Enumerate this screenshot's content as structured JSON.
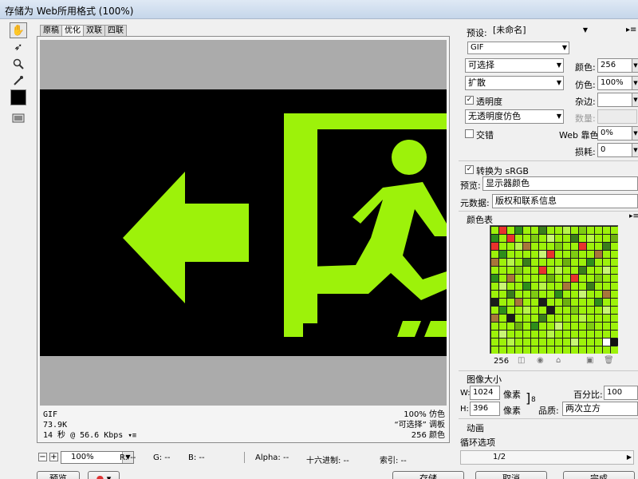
{
  "window": {
    "title": "存储为 Web所用格式 (100%)"
  },
  "tabs": [
    {
      "label": "原稿",
      "active": false
    },
    {
      "label": "优化",
      "active": true
    },
    {
      "label": "双联",
      "active": false
    },
    {
      "label": "四联",
      "active": false
    }
  ],
  "tools": [
    "hand-icon",
    "slice-select-icon",
    "zoom-icon",
    "eyedropper-icon"
  ],
  "colors": {
    "sign_green": "#9df20a",
    "sign_black": "#000000",
    "canvas_gray": "#ababab"
  },
  "info": {
    "format": "GIF",
    "size": "73.9K",
    "time": "14 秒 @ 56.6 Kbps",
    "dither": "100% 仿色",
    "palette": "“可选择” 调板",
    "colors": "256 颜色"
  },
  "status": {
    "zoom": "100%",
    "r": "R: --",
    "g": "G: --",
    "b": "B: --",
    "alpha": "Alpha: --",
    "hex": "十六进制: --",
    "index": "索引: --"
  },
  "buttons": {
    "preview": "预览",
    "save": "存储",
    "cancel": "取消",
    "done": "完成"
  },
  "settings": {
    "preset_label": "预设:",
    "preset_value": "[未命名]",
    "format": "GIF",
    "reduction": "可选择",
    "colors_label": "颜色:",
    "colors_value": "256",
    "dither_algo": "扩散",
    "dither_label": "仿色:",
    "dither_value": "100%",
    "transparency_label": "透明度",
    "transparency_checked": true,
    "matte_label": "杂边:",
    "trans_dither": "无透明度仿色",
    "amount_label": "数量:",
    "interlaced_label": "交错",
    "interlaced_checked": false,
    "websnap_label": "Web 靠色:",
    "websnap_value": "0%",
    "lossy_label": "损耗:",
    "lossy_value": "0",
    "srgb_label": "转换为 sRGB",
    "srgb_checked": true,
    "preview_label": "预览:",
    "preview_value": "显示器颜色",
    "metadata_label": "元数据:",
    "metadata_value": "版权和联系信息"
  },
  "color_table": {
    "title": "颜色表",
    "count": "256",
    "swatches": [
      "#9df20a",
      "#e8332d",
      "#9df20a",
      "#2d8e1a",
      "#9df20a",
      "#9df20a",
      "#3a7d1b",
      "#9df20a",
      "#9df20a",
      "#b8f54a",
      "#9df20a",
      "#7fcc12",
      "#9df20a",
      "#9df20a",
      "#9df20a",
      "#9df20a",
      "#2d8e1a",
      "#9df20a",
      "#e8332d",
      "#9df20a",
      "#9df20a",
      "#7fcc12",
      "#9df20a",
      "#c9f575",
      "#9df20a",
      "#9df20a",
      "#3a7d1b",
      "#9df20a",
      "#b8f54a",
      "#9df20a",
      "#9df20a",
      "#6db00f",
      "#e8332d",
      "#9df20a",
      "#9df20a",
      "#b8f54a",
      "#a8763a",
      "#9df20a",
      "#9df20a",
      "#9df20a",
      "#7fcc12",
      "#9df20a",
      "#9df20a",
      "#e8332d",
      "#9df20a",
      "#9df20a",
      "#3a7d1b",
      "#9df20a",
      "#9df20a",
      "#2d8e1a",
      "#9df20a",
      "#9df20a",
      "#9df20a",
      "#9df20a",
      "#c9f575",
      "#e8332d",
      "#9df20a",
      "#9df20a",
      "#7fcc12",
      "#9df20a",
      "#9df20a",
      "#a8763a",
      "#9df20a",
      "#9df20a",
      "#a8763a",
      "#9df20a",
      "#b8f54a",
      "#9df20a",
      "#3a7d1b",
      "#9df20a",
      "#9df20a",
      "#9df20a",
      "#9df20a",
      "#6db00f",
      "#9df20a",
      "#9df20a",
      "#2d8e1a",
      "#9df20a",
      "#9df20a",
      "#9df20a",
      "#9df20a",
      "#9df20a",
      "#9df20a",
      "#7fcc12",
      "#9df20a",
      "#9df20a",
      "#e8332d",
      "#9df20a",
      "#b8f54a",
      "#9df20a",
      "#9df20a",
      "#3a7d1b",
      "#9df20a",
      "#9df20a",
      "#c9f575",
      "#9df20a",
      "#2d8e1a",
      "#9df20a",
      "#a8763a",
      "#9df20a",
      "#9df20a",
      "#9df20a",
      "#9df20a",
      "#6db00f",
      "#9df20a",
      "#9df20a",
      "#e8332d",
      "#9df20a",
      "#9df20a",
      "#7fcc12",
      "#9df20a",
      "#9df20a",
      "#9df20a",
      "#c9f575",
      "#9df20a",
      "#9df20a",
      "#2d8e1a",
      "#9df20a",
      "#b8f54a",
      "#9df20a",
      "#9df20a",
      "#a8763a",
      "#9df20a",
      "#9df20a",
      "#3a7d1b",
      "#9df20a",
      "#9df20a",
      "#9df20a",
      "#9df20a",
      "#9df20a",
      "#3a7d1b",
      "#9df20a",
      "#9df20a",
      "#7fcc12",
      "#9df20a",
      "#9df20a",
      "#2d8e1a",
      "#9df20a",
      "#9df20a",
      "#c9f575",
      "#9df20a",
      "#9df20a",
      "#a8763a",
      "#9df20a",
      "#1b1b1b",
      "#9df20a",
      "#9df20a",
      "#a8763a",
      "#9df20a",
      "#9df20a",
      "#1b1b1b",
      "#9df20a",
      "#9df20a",
      "#6db00f",
      "#9df20a",
      "#9df20a",
      "#9df20a",
      "#2d8e1a",
      "#9df20a",
      "#9df20a",
      "#9df20a",
      "#2d8e1a",
      "#9df20a",
      "#9df20a",
      "#b8f54a",
      "#9df20a",
      "#9df20a",
      "#1b1b1b",
      "#9df20a",
      "#9df20a",
      "#7fcc12",
      "#9df20a",
      "#9df20a",
      "#9df20a",
      "#c9f575",
      "#9df20a",
      "#a8763a",
      "#9df20a",
      "#1b1b1b",
      "#9df20a",
      "#9df20a",
      "#9df20a",
      "#3a7d1b",
      "#9df20a",
      "#9df20a",
      "#9df20a",
      "#9df20a",
      "#b8f54a",
      "#9df20a",
      "#9df20a",
      "#9df20a",
      "#9df20a",
      "#9df20a",
      "#9df20a",
      "#9df20a",
      "#6db00f",
      "#9df20a",
      "#2d8e1a",
      "#9df20a",
      "#9df20a",
      "#c9f575",
      "#9df20a",
      "#9df20a",
      "#9df20a",
      "#7fcc12",
      "#9df20a",
      "#9df20a",
      "#9df20a",
      "#9df20a",
      "#c9f575",
      "#9df20a",
      "#9df20a",
      "#9df20a",
      "#9df20a",
      "#9df20a",
      "#b8f54a",
      "#9df20a",
      "#9df20a",
      "#9df20a",
      "#9df20a",
      "#9df20a",
      "#9df20a",
      "#9df20a",
      "#9df20a",
      "#9df20a",
      "#9df20a",
      "#b8f54a",
      "#9df20a",
      "#9df20a",
      "#9df20a",
      "#9df20a",
      "#9df20a",
      "#9df20a",
      "#9df20a",
      "#c9f575",
      "#9df20a",
      "#9df20a",
      "#9df20a",
      "#ffffff",
      "#111111",
      "#9df20a",
      "#9df20a",
      "#9df20a",
      "#9df20a",
      "#9df20a",
      "#9df20a",
      "#9df20a",
      "#9df20a",
      "#9df20a",
      "#9df20a",
      "#9df20a",
      "#9df20a",
      "#9df20a",
      "#9df20a",
      "#9df20a",
      "#9df20a"
    ]
  },
  "image_size": {
    "title": "图像大小",
    "w_label": "W:",
    "w_value": "1024",
    "h_label": "H:",
    "h_value": "396",
    "unit": "像素",
    "percent_label": "百分比:",
    "percent_value": "100",
    "quality_label": "品质:",
    "quality_value": "两次立方"
  },
  "animation": {
    "title": "动画",
    "loop_label": "循环选项",
    "frame": "1/2"
  }
}
